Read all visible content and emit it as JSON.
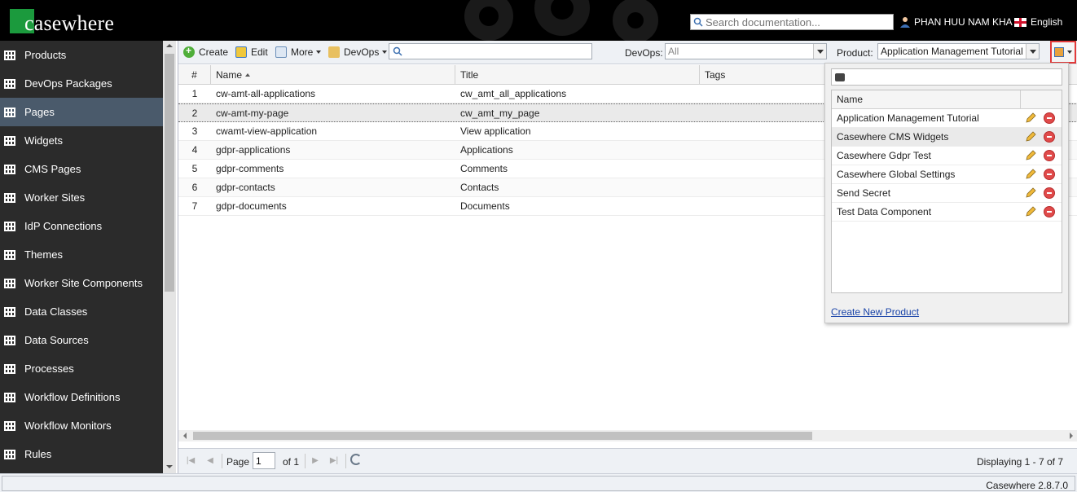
{
  "header": {
    "logo_text": "casewhere",
    "search_placeholder": "Search documentation...",
    "user_name": "PHAN HUU NAM KHA",
    "language": "English"
  },
  "sidebar": {
    "items": [
      {
        "label": "Products"
      },
      {
        "label": "DevOps Packages"
      },
      {
        "label": "Pages",
        "active": true
      },
      {
        "label": "Widgets"
      },
      {
        "label": "CMS Pages"
      },
      {
        "label": "Worker Sites"
      },
      {
        "label": "IdP Connections"
      },
      {
        "label": "Themes"
      },
      {
        "label": "Worker Site Components"
      },
      {
        "label": "Data Classes"
      },
      {
        "label": "Data Sources"
      },
      {
        "label": "Processes"
      },
      {
        "label": "Workflow Definitions"
      },
      {
        "label": "Workflow Monitors"
      },
      {
        "label": "Rules"
      }
    ]
  },
  "toolbar": {
    "create_label": "Create",
    "edit_label": "Edit",
    "more_label": "More",
    "devops_label": "DevOps",
    "search_value": "",
    "devops_filter_label": "DevOps:",
    "devops_filter_value": "All",
    "product_label": "Product:",
    "product_value": "Application Management Tutorial"
  },
  "grid": {
    "columns": {
      "num": "#",
      "name": "Name",
      "title": "Title",
      "tags": "Tags"
    },
    "rows": [
      {
        "num": "1",
        "name": "cw-amt-all-applications",
        "title": "cw_amt_all_applications",
        "tags": ""
      },
      {
        "num": "2",
        "name": "cw-amt-my-page",
        "title": "cw_amt_my_page",
        "tags": ""
      },
      {
        "num": "3",
        "name": "cwamt-view-application",
        "title": "View application",
        "tags": ""
      },
      {
        "num": "4",
        "name": "gdpr-applications",
        "title": "Applications",
        "tags": ""
      },
      {
        "num": "5",
        "name": "gdpr-comments",
        "title": "Comments",
        "tags": ""
      },
      {
        "num": "6",
        "name": "gdpr-contacts",
        "title": "Contacts",
        "tags": ""
      },
      {
        "num": "7",
        "name": "gdpr-documents",
        "title": "Documents",
        "tags": ""
      }
    ]
  },
  "pager": {
    "page_label": "Page",
    "page_value": "1",
    "of_label": "of 1",
    "display_text": "Displaying 1 - 7 of 7"
  },
  "product_dropdown": {
    "search_value": "",
    "column_name": "Name",
    "items": [
      {
        "name": "Application Management Tutorial"
      },
      {
        "name": "Casewhere CMS Widgets"
      },
      {
        "name": "Casewhere Gdpr Test"
      },
      {
        "name": "Casewhere Global Settings"
      },
      {
        "name": "Send Secret"
      },
      {
        "name": "Test Data Component"
      }
    ],
    "create_link": "Create New Product"
  },
  "footer": {
    "version": "Casewhere 2.8.7.0"
  },
  "colors": {
    "header_bg": "#000000",
    "sidebar_bg": "#2b2b2b",
    "sidebar_active": "#4a5a6b",
    "logo_green": "#1b9a3d",
    "highlight_red": "#e23a3a",
    "link_blue": "#1a44a8"
  }
}
